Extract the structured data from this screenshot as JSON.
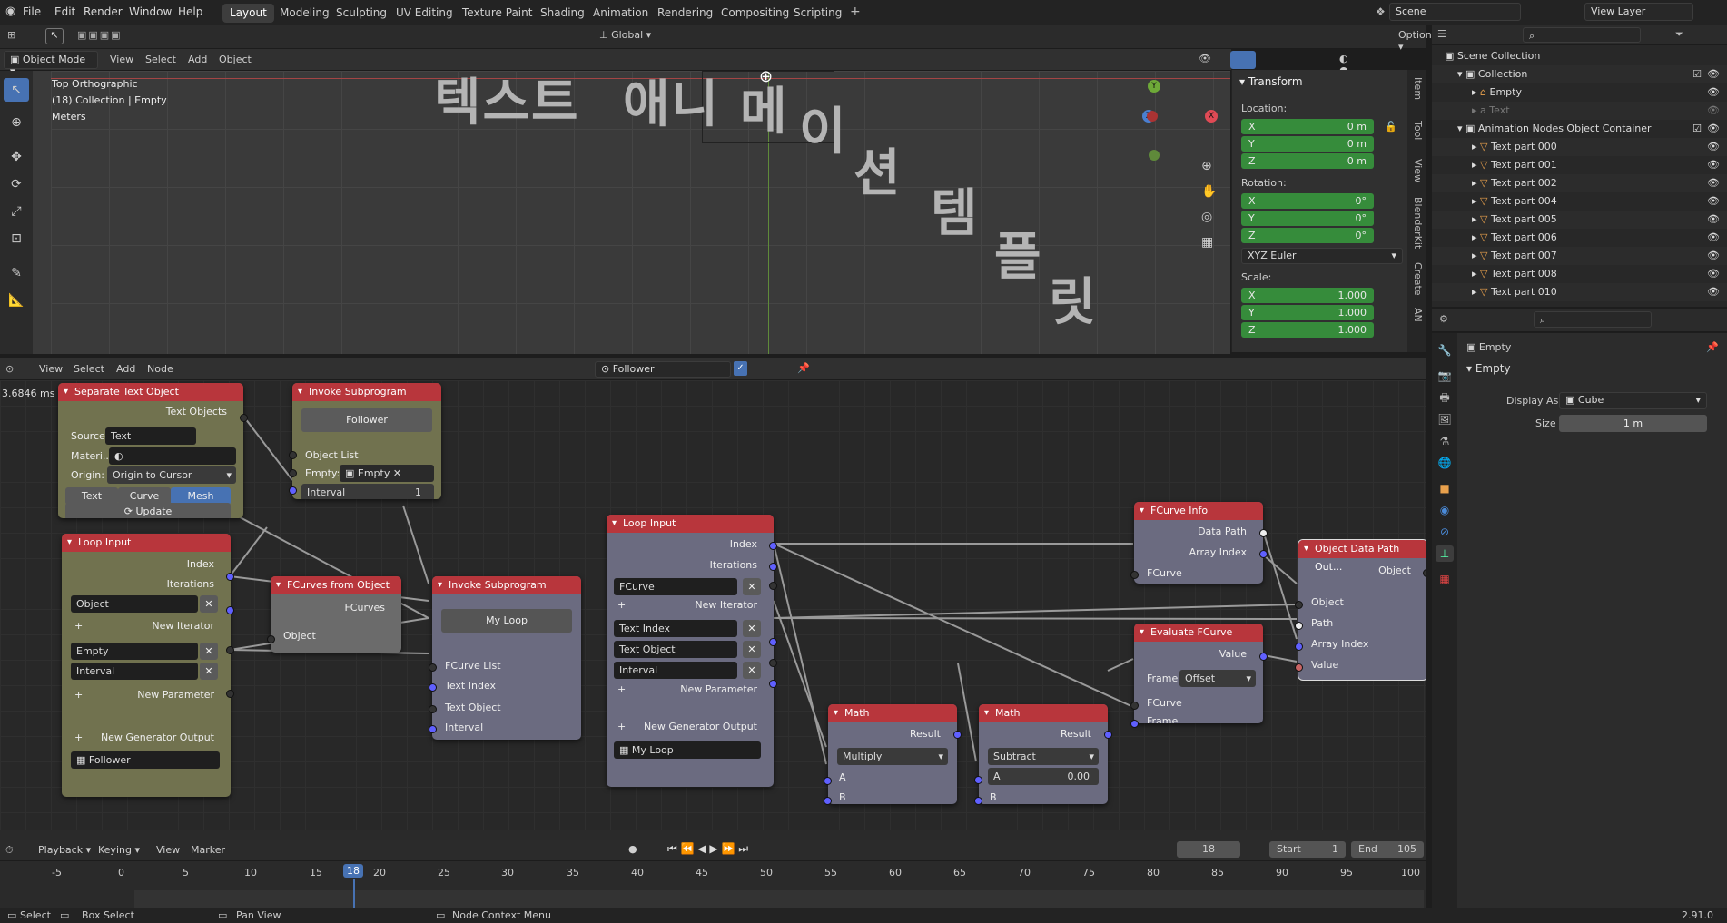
{
  "topbar": {
    "menus": [
      "File",
      "Edit",
      "Render",
      "Window",
      "Help"
    ],
    "workspaces": [
      "Layout",
      "Modeling",
      "Sculpting",
      "UV Editing",
      "Texture Paint",
      "Shading",
      "Animation",
      "Rendering",
      "Compositing",
      "Scripting"
    ],
    "scene": "Scene",
    "view_layer": "View Layer"
  },
  "viewport": {
    "mode": "Object Mode",
    "menus": [
      "View",
      "Select",
      "Add",
      "Object"
    ],
    "orientation": "Global",
    "options": "Options",
    "info": [
      "Top Orthographic",
      "(18) Collection | Empty",
      "Meters"
    ],
    "korean": [
      "텍스트",
      "애니",
      "메",
      "이",
      "션",
      "템",
      "플",
      "릿"
    ]
  },
  "npanel": {
    "title": "Transform",
    "location": "Location:",
    "rotation": "Rotation:",
    "scale": "Scale:",
    "loc": [
      {
        "axis": "X",
        "value": "0 m"
      },
      {
        "axis": "Y",
        "value": "0 m"
      },
      {
        "axis": "Z",
        "value": "0 m"
      }
    ],
    "rot": [
      {
        "axis": "X",
        "value": "0°"
      },
      {
        "axis": "Y",
        "value": "0°"
      },
      {
        "axis": "Z",
        "value": "0°"
      }
    ],
    "euler": "XYZ Euler",
    "scl": [
      {
        "axis": "X",
        "value": "1.000"
      },
      {
        "axis": "Y",
        "value": "1.000"
      },
      {
        "axis": "Z",
        "value": "1.000"
      }
    ],
    "tabs": [
      "Item",
      "Tool",
      "View",
      "BlenderKit",
      "Create",
      "AN"
    ]
  },
  "outliner": {
    "rows": [
      "Scene Collection",
      "Collection",
      "Empty",
      "Text",
      "Animation Nodes Object Container",
      "Text part 000",
      "Text part 001",
      "Text part 002",
      "Text part 004",
      "Text part 005",
      "Text part 006",
      "Text part 007",
      "Text part 008",
      "Text part 010"
    ]
  },
  "props": {
    "object": "Empty",
    "section": "Empty",
    "display_as_label": "Display As",
    "display_as": "Cube",
    "size_label": "Size",
    "size": "1 m"
  },
  "nodeeditor": {
    "menus": [
      "View",
      "Select",
      "Add",
      "Node"
    ],
    "tree": "Follower",
    "timing": "3.6846 ms"
  },
  "nodes": {
    "sep": {
      "title": "Separate Text Object",
      "out": "Text Objects",
      "source_label": "Source:",
      "source": "Text",
      "mat_label": "Materi...",
      "origin_label": "Origin:",
      "origin": "Origin to Cursor",
      "b1": "Text",
      "b2": "Curve",
      "b3": "Mesh",
      "update": "Update"
    },
    "inv1": {
      "title": "Invoke Subprogram",
      "prog": "Follower",
      "l1": "Object List",
      "empty_label": "Empty:",
      "empty": "Empty",
      "interval_label": "Interval",
      "interval": "1"
    },
    "loop1": {
      "title": "Loop Input",
      "index": "Index",
      "iters": "Iterations",
      "f1": "Object",
      "newit": "New Iterator",
      "f2": "Empty",
      "f3": "Interval",
      "newparam": "New Parameter",
      "newgen": "New Generator Output",
      "gen": "Follower"
    },
    "fco": {
      "title": "FCurves from Object",
      "out": "FCurves",
      "in": "Object"
    },
    "inv2": {
      "title": "Invoke Subprogram",
      "prog": "My Loop",
      "l1": "FCurve List",
      "l2": "Text Index",
      "l3": "Text Object",
      "l4": "Interval"
    },
    "loop2": {
      "title": "Loop Input",
      "index": "Index",
      "iters": "Iterations",
      "f1": "FCurve",
      "newit": "New Iterator",
      "f2": "Text Index",
      "f3": "Text Object",
      "f4": "Interval",
      "newparam": "New Parameter",
      "newgen": "New Generator Output",
      "gen": "My Loop"
    },
    "math1": {
      "title": "Math",
      "result": "Result",
      "op": "Multiply",
      "a": "A",
      "b": "B"
    },
    "math2": {
      "title": "Math",
      "result": "Result",
      "op": "Subtract",
      "a": "A",
      "aval": "0.00",
      "b": "B"
    },
    "fci": {
      "title": "FCurve Info",
      "dp": "Data Path",
      "ai": "Array Index",
      "in": "FCurve"
    },
    "eval": {
      "title": "Evaluate FCurve",
      "value": "Value",
      "frame_label": "Frame:",
      "frame": "Offset",
      "fc": "FCurve",
      "fr": "Frame"
    },
    "odp": {
      "title": "Object Data Path Out...",
      "out": "Object",
      "i1": "Object",
      "i2": "Path",
      "i3": "Array Index",
      "i4": "Value"
    }
  },
  "timeline": {
    "menus": [
      "Playback",
      "Keying",
      "View",
      "Marker"
    ],
    "current": "18",
    "start_label": "Start",
    "start": "1",
    "end_label": "End",
    "end": "105",
    "ticks": [
      "-5",
      "0",
      "5",
      "10",
      "15",
      "18",
      "20",
      "25",
      "30",
      "35",
      "40",
      "45",
      "50",
      "55",
      "60",
      "65",
      "70",
      "75",
      "80",
      "85",
      "90",
      "95",
      "100"
    ]
  },
  "status": {
    "select": "Select",
    "box": "Box Select",
    "pan": "Pan View",
    "ctx": "Node Context Menu",
    "version": "2.91.0"
  }
}
